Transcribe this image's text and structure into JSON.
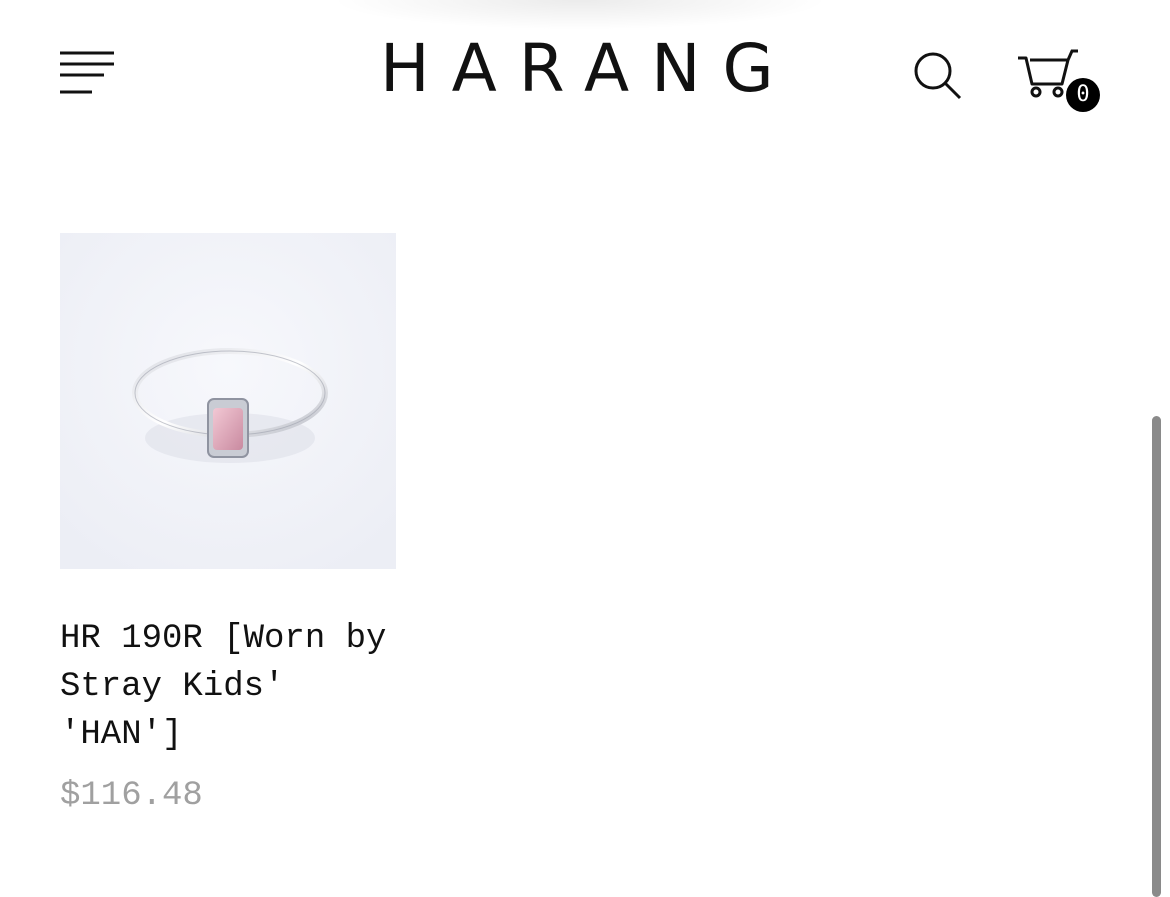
{
  "header": {
    "logo_text": "HARANG",
    "cart_count": "0",
    "menu_icon": "hamburger-menu-icon",
    "search_icon": "search-icon",
    "cart_icon": "cart-icon"
  },
  "products": [
    {
      "title": "HR 190R [Worn by Stray Kids' 'HAN']",
      "price": "$116.48",
      "image": "silver ring with pink square stone"
    }
  ],
  "colors": {
    "text": "#111111",
    "price": "#a0a0a0",
    "badge": "#000000"
  }
}
